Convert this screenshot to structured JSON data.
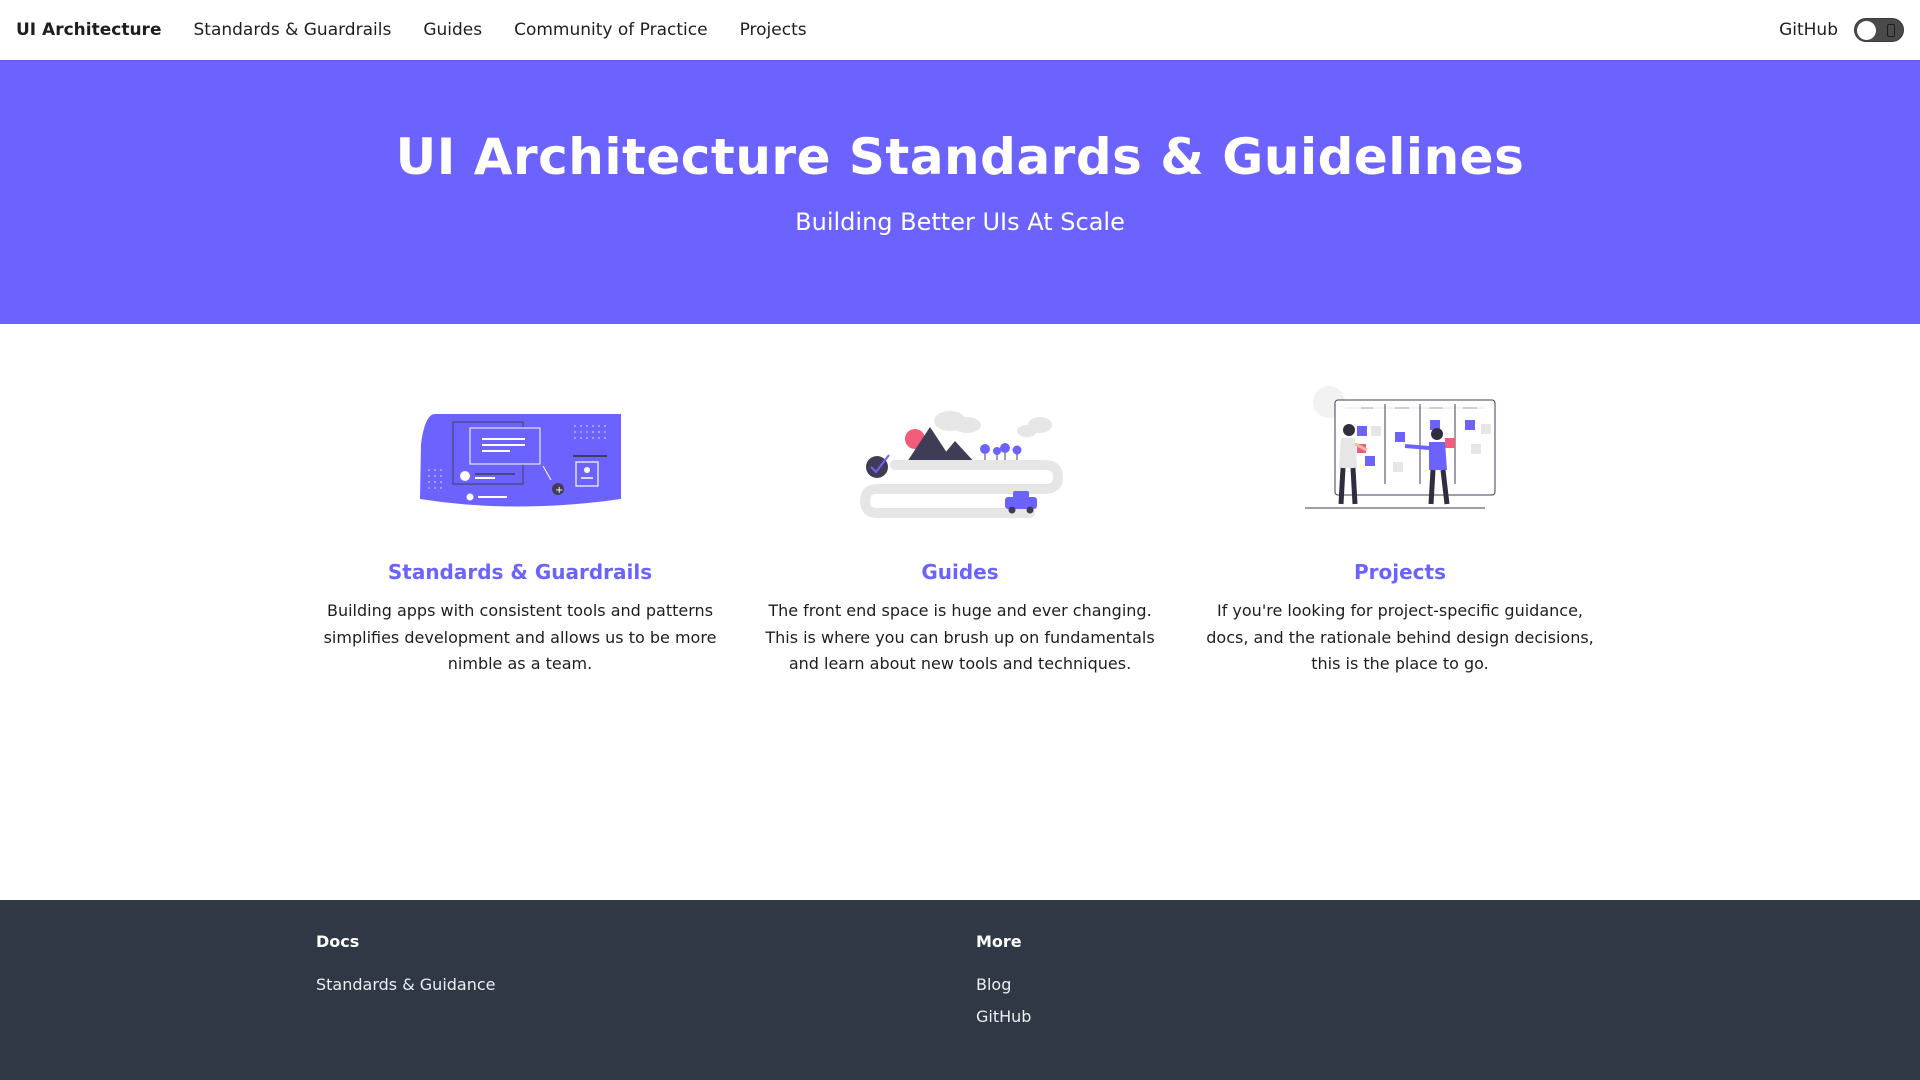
{
  "navbar": {
    "brand": "UI Architecture",
    "links": [
      "Standards & Guardrails",
      "Guides",
      "Community of Practice",
      "Projects"
    ],
    "github": "GitHub"
  },
  "hero": {
    "title": "UI Architecture Standards & Guidelines",
    "subtitle": "Building Better UIs At Scale"
  },
  "features": [
    {
      "title": "Standards & Guardrails",
      "description": "Building apps with consistent tools and patterns simplifies development and allows us to be more nimble as a team.",
      "illustration": "ui-layout-illustration"
    },
    {
      "title": "Guides",
      "description": "The front end space is huge and ever changing. This is where you can brush up on fundamentals and learn about new tools and techniques.",
      "illustration": "mountain-road-illustration"
    },
    {
      "title": "Projects",
      "description": "If you're looking for project-specific guidance, docs, and the rationale behind design decisions, this is the place to go.",
      "illustration": "kanban-board-illustration"
    }
  ],
  "footer": {
    "columns": [
      {
        "title": "Docs",
        "links": [
          "Standards & Guidance"
        ]
      },
      {
        "title": "More",
        "links": [
          "Blog",
          "GitHub"
        ]
      }
    ]
  },
  "colors": {
    "primary": "#6c63ff",
    "footer_bg": "#303846",
    "accent_pink": "#f25c7a"
  }
}
